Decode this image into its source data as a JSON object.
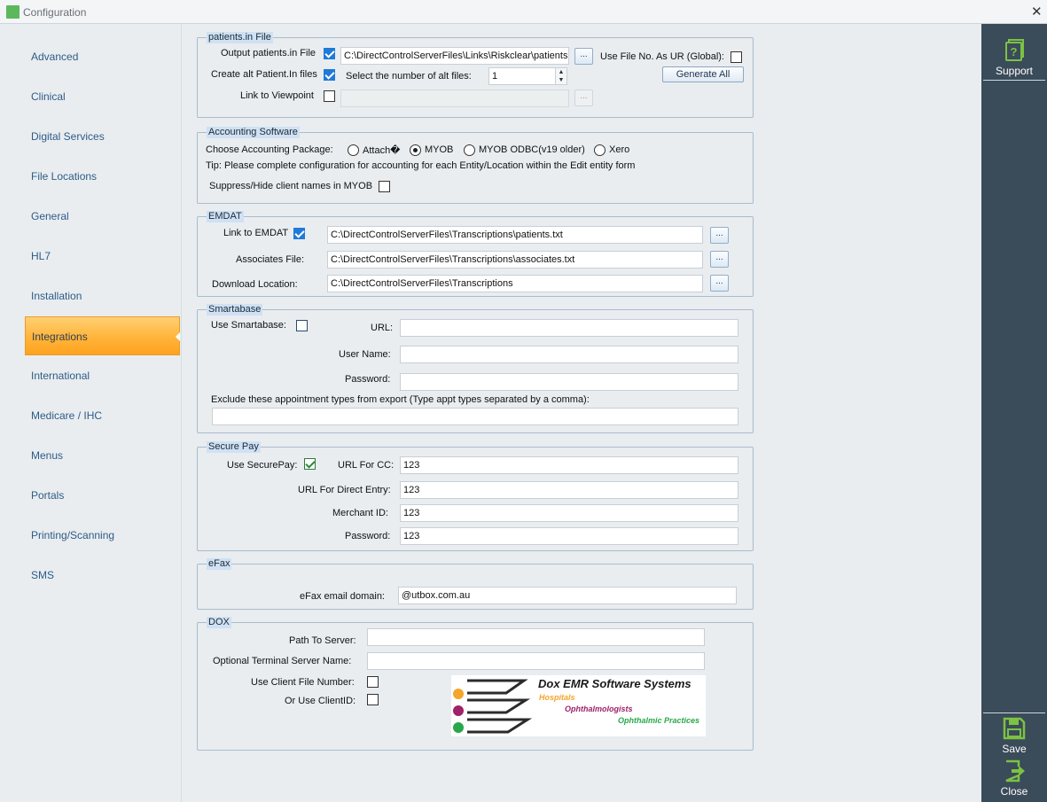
{
  "window": {
    "title": "Configuration",
    "close_glyph": "✕"
  },
  "sidebar": {
    "items": [
      {
        "label": "Advanced"
      },
      {
        "label": "Clinical"
      },
      {
        "label": "Digital Services"
      },
      {
        "label": "File Locations"
      },
      {
        "label": "General"
      },
      {
        "label": "HL7"
      },
      {
        "label": "Installation"
      },
      {
        "label": "Integrations"
      },
      {
        "label": "International"
      },
      {
        "label": "Medicare / IHC"
      },
      {
        "label": "Menus"
      },
      {
        "label": "Portals"
      },
      {
        "label": "Printing/Scanning"
      },
      {
        "label": "SMS"
      }
    ],
    "active": "Integrations"
  },
  "patients": {
    "title": "patients.in File",
    "output_label": "Output patients.in File",
    "output_checked": true,
    "output_path": "C:\\DirectControlServerFiles\\Links\\Riskclear\\patients.",
    "browse": "...",
    "use_file_no_label": "Use File No. As UR (Global):",
    "use_file_no_checked": false,
    "create_alt_label": "Create alt Patient.In files",
    "create_alt_checked": true,
    "select_number_label": "Select the number of alt files:",
    "alt_files_value": "1",
    "generate_all": "Generate All",
    "link_viewpoint_label": "Link to Viewpoint",
    "link_viewpoint_checked": false,
    "viewpoint_path": "",
    "viewpoint_browse": "..."
  },
  "accounting": {
    "title": "Accounting Software",
    "choose_label": "Choose Accounting Package:",
    "options": [
      "Attach�",
      "MYOB",
      "MYOB ODBC(v19 older)",
      "Xero"
    ],
    "selected": "MYOB",
    "tip": "Tip: Please complete configuration for accounting for each Entity/Location within the Edit entity form",
    "suppress_label": "Suppress/Hide client names in MYOB",
    "suppress_checked": false
  },
  "emdat": {
    "title": "EMDAT",
    "link_label": "Link to EMDAT",
    "link_checked": true,
    "link_path": "C:\\DirectControlServerFiles\\Transcriptions\\patients.txt",
    "associates_label": "Associates File:",
    "associates_path": "C:\\DirectControlServerFiles\\Transcriptions\\associates.txt",
    "download_label": "Download Location:",
    "download_path": "C:\\DirectControlServerFiles\\Transcriptions",
    "browse": "..."
  },
  "smartabase": {
    "title": "Smartabase",
    "use_label": "Use Smartabase:",
    "use_checked": false,
    "url_label": "URL:",
    "url_value": "",
    "username_label": "User Name:",
    "username_value": "",
    "password_label": "Password:",
    "password_value": "",
    "exclude_label": "Exclude these appointment types from export (Type appt types separated by a comma):",
    "exclude_value": ""
  },
  "securepay": {
    "title": "Secure Pay",
    "use_label": "Use SecurePay:",
    "use_checked": true,
    "url_cc_label": "URL For CC:",
    "url_cc_value": "123",
    "url_direct_label": "URL For Direct Entry:",
    "url_direct_value": "123",
    "merchant_label": "Merchant ID:",
    "merchant_value": "123",
    "password_label": "Password:",
    "password_value": "123"
  },
  "efax": {
    "title": "eFax",
    "domain_label": "eFax email domain:",
    "domain_value": "@utbox.com.au"
  },
  "dox": {
    "title": "DOX",
    "path_label": "Path To Server:",
    "path_value": "",
    "terminal_label": "Optional Terminal Server Name:",
    "terminal_value": "",
    "client_file_label": "Use Client File Number:",
    "client_file_checked": false,
    "client_id_label": "Or Use ClientID:",
    "client_id_checked": false,
    "logo": {
      "title": "Dox EMR Software Systems",
      "line1": "Hospitals",
      "line2": "Ophthalmologists",
      "line3": "Ophthalmic Practices",
      "colors": {
        "orange": "#f4a52c",
        "purple": "#a0206a",
        "green": "#28a84a"
      }
    }
  },
  "right_panel": {
    "support": "Support",
    "save": "Save",
    "close": "Close",
    "accent": "#7cc243"
  }
}
